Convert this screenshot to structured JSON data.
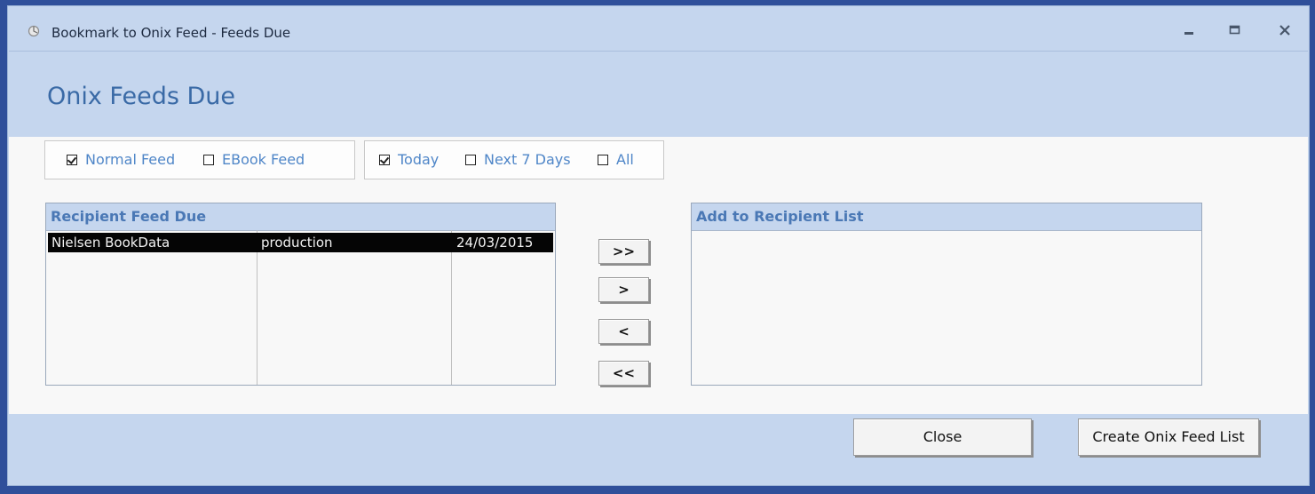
{
  "window": {
    "title": "Bookmark to Onix Feed - Feeds Due",
    "controls": {
      "minimize_icon": "minimize-icon",
      "maximize_icon": "maximize-icon",
      "close_icon": "close-icon"
    }
  },
  "header": {
    "title": "Onix Feeds Due"
  },
  "feed_type": [
    {
      "label": "Normal Feed",
      "checked": true
    },
    {
      "label": "EBook Feed",
      "checked": false
    }
  ],
  "period": [
    {
      "label": "Today",
      "checked": true
    },
    {
      "label": "Next 7 Days",
      "checked": false
    },
    {
      "label": "All",
      "checked": false
    }
  ],
  "recipient_due": {
    "header": "Recipient Feed Due",
    "rows": [
      {
        "name": "Nielsen BookData",
        "environment": "production",
        "date": "24/03/2015",
        "selected": true
      }
    ]
  },
  "transfer_buttons": {
    "add_all": ">>",
    "add": ">",
    "remove": "<",
    "remove_all": "<<"
  },
  "recipient_list": {
    "header": "Add to Recipient List",
    "rows": []
  },
  "footer": {
    "close_label": "Close",
    "create_label": "Create Onix Feed List"
  },
  "colors": {
    "accent": "#4f86c8",
    "panel": "#c5d6ee",
    "selected_row": "#050505",
    "desktop": "#2f4f9a"
  }
}
